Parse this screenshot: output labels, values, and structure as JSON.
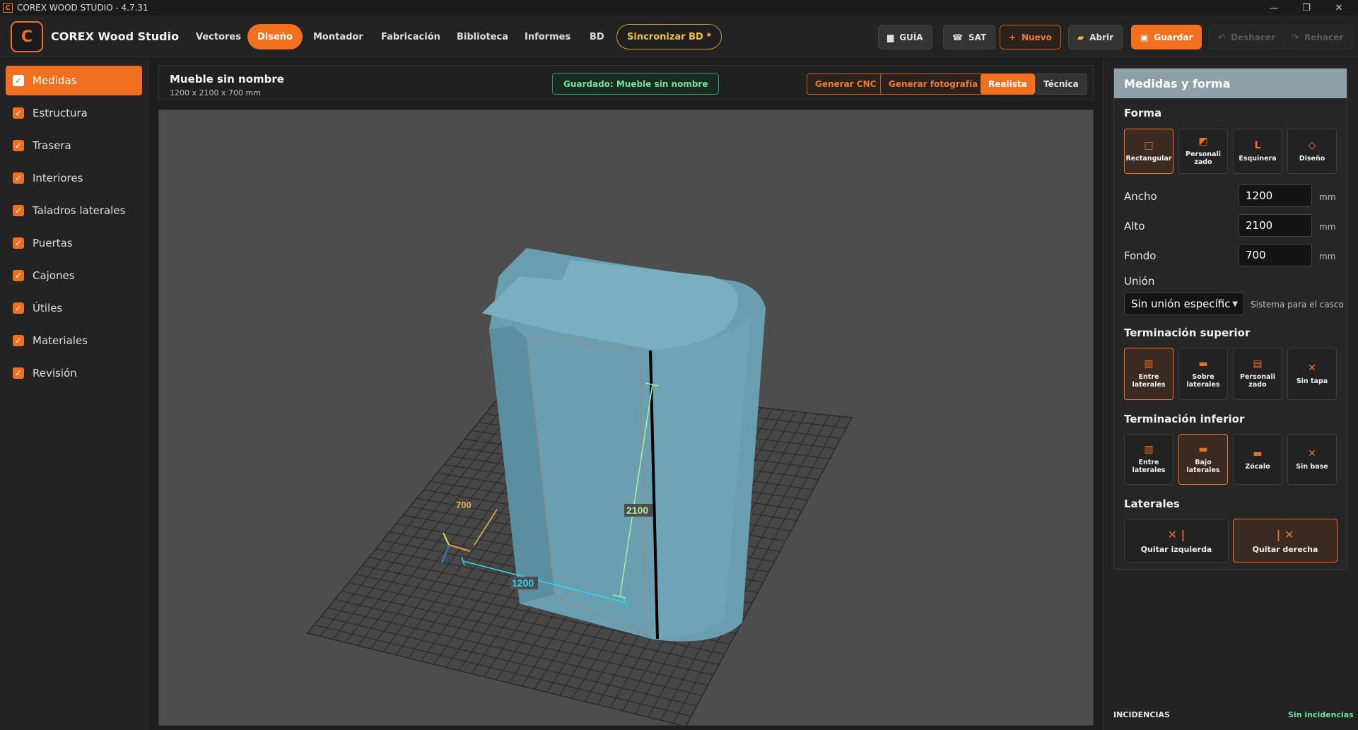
{
  "window": {
    "title": "COREX WOOD STUDIO - 4.7.31",
    "app_icon": "C",
    "minimize": "—",
    "maximize": "❐",
    "close": "✕"
  },
  "brand": {
    "logo_letter": "C",
    "name": "COREX Wood Studio"
  },
  "nav": {
    "tabs": [
      "Vectores",
      "Diseño",
      "Montador",
      "Fabricación",
      "Biblioteca",
      "Informes",
      "BD"
    ],
    "active_tab": "Diseño",
    "sync_label": "Sincronizar BD *"
  },
  "actions": {
    "guia": "GUÍA",
    "sat": "SAT",
    "nuevo": "Nuevo",
    "abrir": "Abrir",
    "guardar": "Guardar",
    "deshacer": "Deshacer",
    "rehacer": "Rehacer"
  },
  "sidebar": {
    "items": [
      "Medidas",
      "Estructura",
      "Trasera",
      "Interiores",
      "Taladros laterales",
      "Puertas",
      "Cajones",
      "Útiles",
      "Materiales",
      "Revisión"
    ],
    "active": "Medidas",
    "check_glyph": "✓"
  },
  "document": {
    "title": "Mueble sin nombre",
    "dimensions": "1200 x 2100 x 700 mm",
    "saved_status": "Guardado: Mueble sin nombre",
    "generar_cnc": "Generar CNC",
    "generar_foto": "Generar fotografía",
    "view_realista": "Realista",
    "view_tecnica": "Técnica"
  },
  "viewport": {
    "dim_width": "1200",
    "dim_height": "2100",
    "dim_depth": "700",
    "colors": {
      "cabinet": "#6ea4b6",
      "width_dim": "#2ad6f0",
      "height_dim": "#a8f0a0",
      "depth_dim": "#f0b050",
      "grid": "#2e2e2e"
    }
  },
  "panel": {
    "title": "Medidas y forma",
    "forma_title": "Forma",
    "forma_options": [
      {
        "label": "Rectangular",
        "icon": "□",
        "selected": true
      },
      {
        "label": "Personalizado",
        "icon": "◩",
        "selected": false
      },
      {
        "label": "Esquinera",
        "icon": "L",
        "selected": false
      },
      {
        "label": "Diseño",
        "icon": "◇",
        "selected": false
      }
    ],
    "ancho_label": "Ancho",
    "ancho_value": "1200",
    "alto_label": "Alto",
    "alto_value": "2100",
    "fondo_label": "Fondo",
    "fondo_value": "700",
    "unit": "mm",
    "union_label": "Unión",
    "union_value": "Sin unión específic",
    "union_hint": "Sistema para el casco",
    "sup_title": "Terminación superior",
    "sup_options": [
      {
        "label": "Entre laterales",
        "icon": "▥",
        "selected": true
      },
      {
        "label": "Sobre laterales",
        "icon": "▬",
        "selected": false
      },
      {
        "label": "Personalizado",
        "icon": "▤",
        "selected": false
      },
      {
        "label": "Sin tapa",
        "icon": "✕",
        "selected": false
      }
    ],
    "inf_title": "Terminación inferior",
    "inf_options": [
      {
        "label": "Entre laterales",
        "icon": "▥",
        "selected": false
      },
      {
        "label": "Bajo laterales",
        "icon": "▬",
        "selected": true
      },
      {
        "label": "Zócalo",
        "icon": "▬",
        "selected": false
      },
      {
        "label": "Sin base",
        "icon": "✕",
        "selected": false
      }
    ],
    "lat_title": "Laterales",
    "lat_left": "Quitar izquierda",
    "lat_right": "Quitar derecha",
    "lat_left_icon": "✕ |",
    "lat_right_icon": "| ✕"
  },
  "footer": {
    "incidencias": "INCIDENCIAS",
    "status": "Sin incidencias"
  }
}
